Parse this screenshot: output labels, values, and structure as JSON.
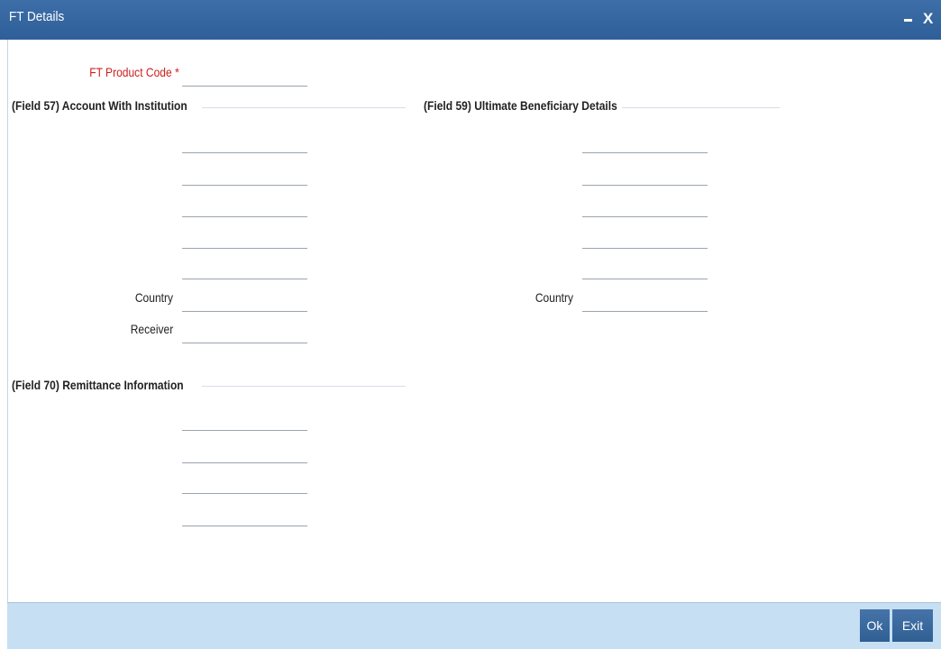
{
  "window": {
    "title": "FT Details",
    "minimize_glyph": "minimize-icon",
    "close_label": "X"
  },
  "product": {
    "label": "FT Product Code",
    "required_mark": "*",
    "value": ""
  },
  "field57": {
    "heading": "(Field 57) Account With Institution",
    "lines": [
      "",
      "",
      "",
      "",
      ""
    ],
    "country_label": "Country",
    "country_value": "",
    "receiver_label": "Receiver",
    "receiver_value": ""
  },
  "field59": {
    "heading": "(Field 59) Ultimate Beneficiary Details",
    "lines": [
      "",
      "",
      "",
      "",
      ""
    ],
    "country_label": "Country",
    "country_value": ""
  },
  "field70": {
    "heading": "(Field 70) Remittance Information",
    "lines": [
      "",
      "",
      "",
      ""
    ]
  },
  "footer": {
    "ok_label": "Ok",
    "exit_label": "Exit"
  },
  "colors": {
    "titlebar": "#2f5f98",
    "required": "#cc1f1f",
    "footer": "#c6dff2",
    "button": "#3a6aa0"
  }
}
